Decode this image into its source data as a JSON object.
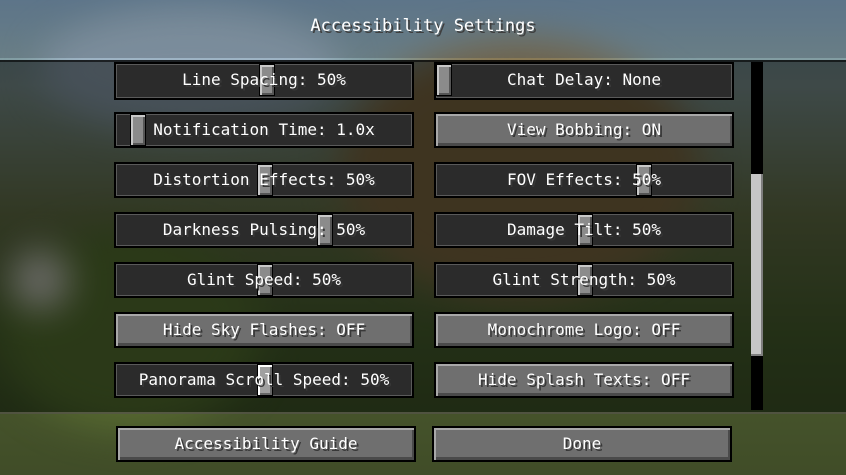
{
  "screen": {
    "title": "Accessibility Settings"
  },
  "options": {
    "left": [
      {
        "label": "Line Spacing: 50%",
        "type": "slider",
        "value": 0.5
      },
      {
        "label": "Notification Time: 1.0x",
        "type": "slider",
        "value": 0.0
      },
      {
        "label": "Distortion Effects: 50%",
        "type": "slider",
        "value": 0.5
      },
      {
        "label": "Darkness Pulsing: 50%",
        "type": "slider",
        "value": 0.7
      },
      {
        "label": "Glint Speed: 50%",
        "type": "slider",
        "value": 0.5
      },
      {
        "label": "Hide Sky Flashes: OFF",
        "type": "button"
      },
      {
        "label": "Panorama Scroll Speed: 50%",
        "type": "slider",
        "value": 0.5
      }
    ],
    "right": [
      {
        "label": "Chat Delay: None",
        "type": "slider",
        "value": 0.0
      },
      {
        "label": "View Bobbing: ON",
        "type": "button"
      },
      {
        "label": "FOV Effects: 50%",
        "type": "slider",
        "value": 0.7
      },
      {
        "label": "Damage Tilt: 50%",
        "type": "slider",
        "value": 0.5
      },
      {
        "label": "Glint Strength: 50%",
        "type": "slider",
        "value": 0.5
      },
      {
        "label": "Monochrome Logo: OFF",
        "type": "button"
      },
      {
        "label": "Hide Splash Texts: OFF",
        "type": "button"
      }
    ]
  },
  "footer": {
    "guide_label": "Accessibility Guide",
    "done_label": "Done"
  }
}
